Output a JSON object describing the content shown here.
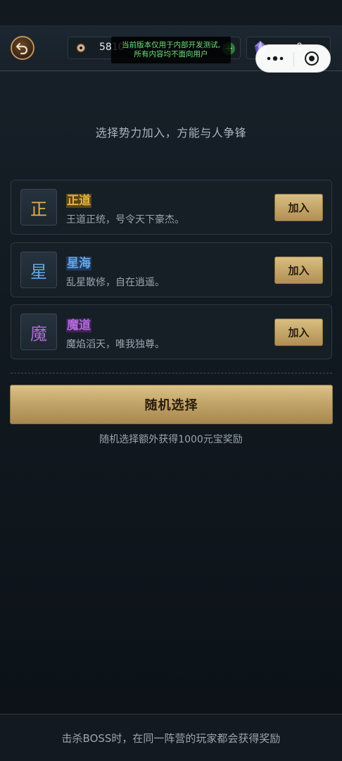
{
  "header": {
    "coin_value": "5810",
    "gem_value": "0",
    "plus_label": "+"
  },
  "test_notice": {
    "line1": "当前版本仅用于内部开发测试,",
    "line2": "所有内容均不面向用户"
  },
  "subtitle": "选择势力加入，方能与人争锋",
  "factions": [
    {
      "badge": "正",
      "name": "正道",
      "desc": "王道正统，号令天下豪杰。",
      "button": "加入",
      "color": "#e0b347",
      "highlight": "#5a4418"
    },
    {
      "badge": "星",
      "name": "星海",
      "desc": "乱星散修，自在逍遥。",
      "button": "加入",
      "color": "#6aa6e6",
      "highlight": "#1e3a5c"
    },
    {
      "badge": "魔",
      "name": "魔道",
      "desc": "魔焰滔天，唯我独尊。",
      "button": "加入",
      "color": "#b06ad6",
      "highlight": "#3d2355"
    }
  ],
  "random": {
    "button": "随机选择",
    "note": "随机选择额外获得1000元宝奖励"
  },
  "footer": "击杀BOSS时，在同一阵营的玩家都会获得奖励",
  "colors": {
    "gold_button": "#c2a568",
    "background": "#121a21",
    "notice_text": "#6ee07a"
  }
}
